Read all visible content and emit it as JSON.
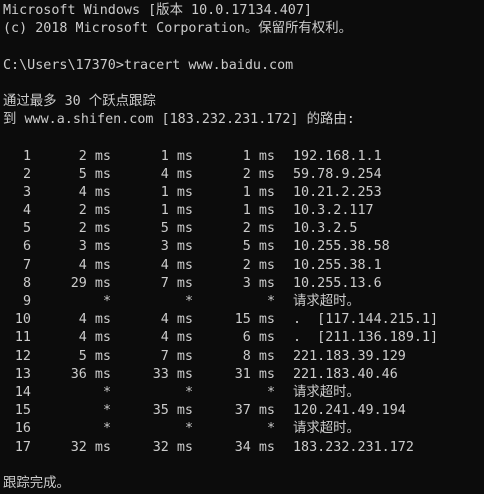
{
  "banner": {
    "line1": "Microsoft Windows [版本 10.0.17134.407]",
    "line2": "(c) 2018 Microsoft Corporation。保留所有权利。"
  },
  "command": {
    "prompt": "C:\\Users\\17370>",
    "text": "tracert www.baidu.com"
  },
  "trace_header": {
    "line1": "通过最多 30 个跃点跟踪",
    "line2": "到 www.a.shifen.com [183.232.231.172] 的路由:"
  },
  "hops": [
    {
      "hop": "1",
      "t1": "2 ms",
      "t2": "1 ms",
      "t3": "1 ms",
      "addr": "192.168.1.1"
    },
    {
      "hop": "2",
      "t1": "5 ms",
      "t2": "4 ms",
      "t3": "2 ms",
      "addr": "59.78.9.254"
    },
    {
      "hop": "3",
      "t1": "4 ms",
      "t2": "1 ms",
      "t3": "1 ms",
      "addr": "10.21.2.253"
    },
    {
      "hop": "4",
      "t1": "2 ms",
      "t2": "1 ms",
      "t3": "1 ms",
      "addr": "10.3.2.117"
    },
    {
      "hop": "5",
      "t1": "2 ms",
      "t2": "5 ms",
      "t3": "2 ms",
      "addr": "10.3.2.5"
    },
    {
      "hop": "6",
      "t1": "3 ms",
      "t2": "3 ms",
      "t3": "5 ms",
      "addr": "10.255.38.58"
    },
    {
      "hop": "7",
      "t1": "4 ms",
      "t2": "4 ms",
      "t3": "2 ms",
      "addr": "10.255.38.1"
    },
    {
      "hop": "8",
      "t1": "29 ms",
      "t2": "7 ms",
      "t3": "3 ms",
      "addr": "10.255.13.6"
    },
    {
      "hop": "9",
      "t1": "*",
      "t2": "*",
      "t3": "*",
      "addr": "请求超时。"
    },
    {
      "hop": "10",
      "t1": "4 ms",
      "t2": "4 ms",
      "t3": "15 ms",
      "addr": ".  [117.144.215.1]"
    },
    {
      "hop": "11",
      "t1": "4 ms",
      "t2": "4 ms",
      "t3": "6 ms",
      "addr": ".  [211.136.189.1]"
    },
    {
      "hop": "12",
      "t1": "5 ms",
      "t2": "7 ms",
      "t3": "8 ms",
      "addr": "221.183.39.129"
    },
    {
      "hop": "13",
      "t1": "36 ms",
      "t2": "33 ms",
      "t3": "31 ms",
      "addr": "221.183.40.46"
    },
    {
      "hop": "14",
      "t1": "*",
      "t2": "*",
      "t3": "*",
      "addr": "请求超时。"
    },
    {
      "hop": "15",
      "t1": "*",
      "t2": "35 ms",
      "t3": "37 ms",
      "addr": "120.241.49.194"
    },
    {
      "hop": "16",
      "t1": "*",
      "t2": "*",
      "t3": "*",
      "addr": "请求超时。"
    },
    {
      "hop": "17",
      "t1": "32 ms",
      "t2": "32 ms",
      "t3": "34 ms",
      "addr": "183.232.231.172"
    }
  ],
  "footer": {
    "complete": "跟踪完成。"
  },
  "colors": {
    "background": "#0c0c0c",
    "text": "#cccccc"
  }
}
